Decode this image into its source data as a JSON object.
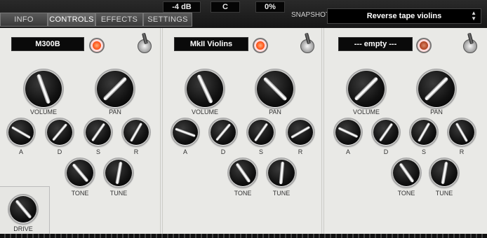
{
  "header": {
    "readouts": [
      "-4 dB",
      "C",
      "0%"
    ],
    "tabs": [
      "INFO",
      "CONTROLS",
      "EFFECTS",
      "SETTINGS"
    ],
    "active_tab": "CONTROLS",
    "snapshot_label": "SNAPSHOT",
    "snapshot_value": "Reverse tape violins"
  },
  "panels": [
    {
      "name": "M300B",
      "led": "on",
      "labels": {
        "volume": "VOLUME",
        "pan": "PAN",
        "a": "A",
        "d": "D",
        "s": "S",
        "r": "R",
        "tone": "TONE",
        "tune": "TUNE"
      }
    },
    {
      "name": "MkII Violins",
      "led": "on",
      "labels": {
        "volume": "VOLUME",
        "pan": "PAN",
        "a": "A",
        "d": "D",
        "s": "S",
        "r": "R",
        "tone": "TONE",
        "tune": "TUNE"
      }
    },
    {
      "name": "--- empty ---",
      "led": "off",
      "labels": {
        "volume": "VOLUME",
        "pan": "PAN",
        "a": "A",
        "d": "D",
        "s": "S",
        "r": "R",
        "tone": "TONE",
        "tune": "TUNE"
      }
    }
  ],
  "drive_label": "DRIVE",
  "colors": {
    "led_on": "#ff4b10",
    "led_off": "#5c1606",
    "panel": "#e9e9e6",
    "display": "#0a0a0a"
  }
}
